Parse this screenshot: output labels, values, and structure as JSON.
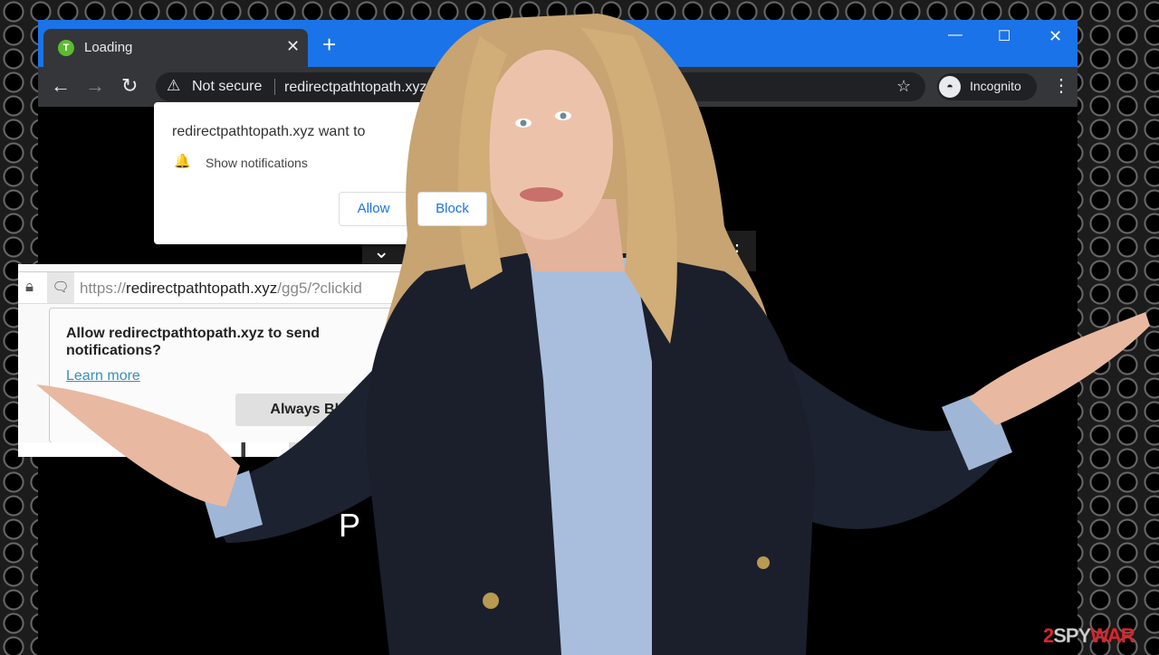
{
  "chrome": {
    "tab_title": "Loading",
    "favicon_letter": "T",
    "security_label": "Not secure",
    "url": "redirectpathtopath.xyz",
    "incognito_label": "Incognito",
    "titlebar_color": "#1a73e8",
    "permission_prompt": {
      "title": "redirectpathtopath.xyz want to",
      "permission": "Show notifications",
      "allow_label": "Allow",
      "block_label": "Block"
    }
  },
  "firefox": {
    "url_prefix": "https://",
    "url_domain": "redirectpathtopath.xyz",
    "url_rest": "/gg5/?clickid",
    "prompt": {
      "question": "Allow redirectpathtopath.xyz to send notifications?",
      "learn_more": "Learn more",
      "always_block": "Always Block"
    }
  },
  "page_text_fragment": "P",
  "watermark": {
    "part1": "2",
    "part2": "SPY",
    "part3": "WAR",
    "accent": "#e0222a"
  }
}
